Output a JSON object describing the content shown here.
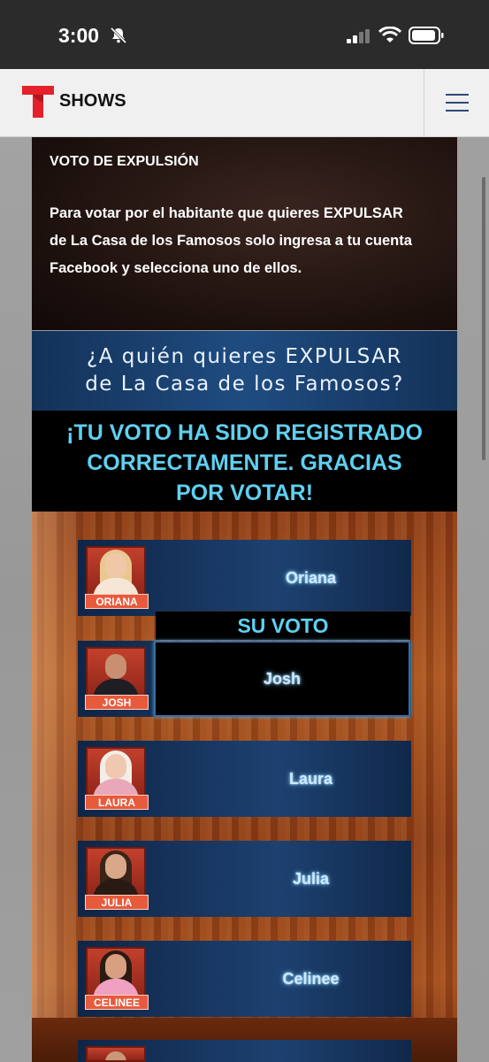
{
  "status_bar": {
    "time": "3:00"
  },
  "nav": {
    "brand": "SHOWS"
  },
  "info": {
    "title": "VOTO DE EXPULSIÓN",
    "body": "Para votar por el habitante que quieres EXPULSAR de La Casa de los Famosos solo ingresa a tu cuenta Facebook y selecciona uno de ellos."
  },
  "question": {
    "line1": "¿A quién quieres EXPULSAR",
    "line2": "de La Casa de los Famosos?"
  },
  "confirmation": {
    "line1": "¡TU VOTO HA SIDO REGISTRADO",
    "line2": "CORRECTAMENTE. GRACIAS",
    "line3": "POR VOTAR!"
  },
  "vote_banner": "SU VOTO",
  "contestants": [
    {
      "tag": "ORIANA",
      "name": "Oriana"
    },
    {
      "tag": "JOSH",
      "name": "Josh",
      "voted": true
    },
    {
      "tag": "LAURA",
      "name": "Laura"
    },
    {
      "tag": "JULIA",
      "name": "Julia"
    },
    {
      "tag": "CELINEE",
      "name": "Celinee"
    }
  ],
  "colors": {
    "accent_cyan": "#5fd0f0",
    "card_blue": "#1d4170",
    "tag_red": "#e85a3c",
    "brand_red": "#e4202a"
  }
}
